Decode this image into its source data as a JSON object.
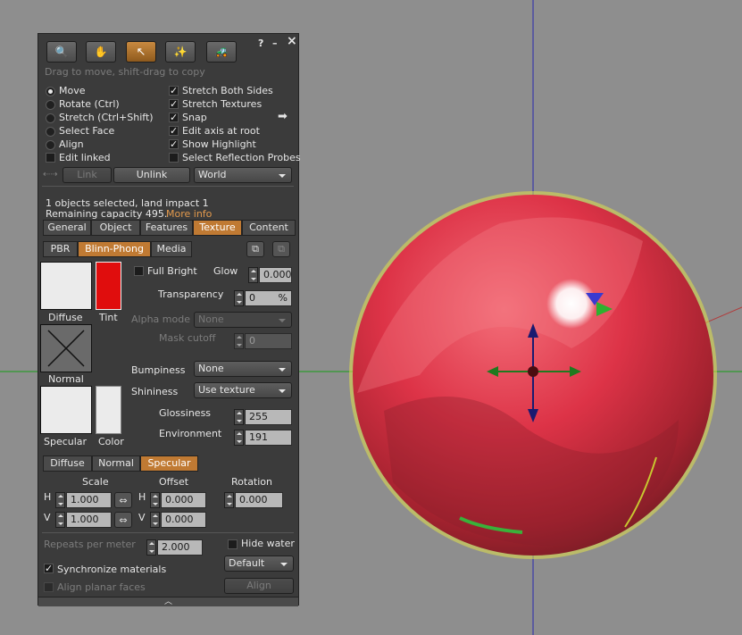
{
  "colors": {
    "accent": "#c07a33",
    "sphere": "#e23a4e",
    "panel": "#3b3b3b"
  },
  "header": {
    "tools": [
      {
        "name": "focus-icon",
        "glyph": "🔍"
      },
      {
        "name": "move-hand-icon",
        "glyph": "✋"
      },
      {
        "name": "edit-pointer-icon",
        "glyph": "↖"
      },
      {
        "name": "create-wand-icon",
        "glyph": "✨"
      },
      {
        "name": "land-bulldozer-icon",
        "glyph": "🚜"
      }
    ],
    "help": "?",
    "minimize": "–",
    "close": "×",
    "hint": "Drag to move, shift-drag to copy"
  },
  "modes": {
    "move": "Move",
    "rotate": "Rotate (Ctrl)",
    "stretch": "Stretch (Ctrl+Shift)",
    "select_face": "Select Face",
    "align": "Align",
    "edit_linked": "Edit linked"
  },
  "options": {
    "stretch_both": "Stretch Both Sides",
    "stretch_textures": "Stretch Textures",
    "snap": "Snap",
    "edit_axis": "Edit axis at root",
    "show_highlight": "Show Highlight",
    "reflection_probes": "Select Reflection Probes"
  },
  "link": {
    "link": "Link",
    "unlink": "Unlink",
    "frame": "World"
  },
  "info": {
    "selected": "1 objects selected, land impact 1",
    "remaining": "Remaining capacity 495.",
    "more_info": "More info"
  },
  "tabs": [
    "General",
    "Object",
    "Features",
    "Texture",
    "Content"
  ],
  "subtabs": [
    "PBR",
    "Blinn-Phong",
    "Media"
  ],
  "texture": {
    "diffuse": "Diffuse",
    "tint": "Tint",
    "normal": "Normal",
    "specular": "Specular",
    "color": "Color",
    "full_bright": "Full Bright",
    "glow": "Glow",
    "glow_value": "0.000",
    "transparency": "Transparency",
    "transparency_value": "0",
    "percent": "%",
    "alpha_mode": "Alpha mode",
    "alpha_value": "None",
    "mask_cutoff": "Mask cutoff",
    "mask_value": "0",
    "bumpiness": "Bumpiness",
    "bumpiness_value": "None",
    "shininess": "Shininess",
    "shininess_value": "Use texture",
    "glossiness": "Glossiness",
    "glossiness_value": "255",
    "environment": "Environment",
    "environment_value": "191"
  },
  "maptabs": [
    "Diffuse",
    "Normal",
    "Specular"
  ],
  "mapping": {
    "scale": "Scale",
    "offset": "Offset",
    "rotation": "Rotation",
    "h": "H",
    "v": "V",
    "scale_h": "1.000",
    "scale_v": "1.000",
    "offset_h": "0.000",
    "offset_v": "0.000",
    "rotation_value": "0.000"
  },
  "bottom": {
    "repeats": "Repeats per meter",
    "repeats_value": "2.000",
    "hide_water": "Hide water",
    "sync": "Synchronize materials",
    "align_planar": "Align planar faces",
    "default": "Default",
    "align": "Align"
  }
}
